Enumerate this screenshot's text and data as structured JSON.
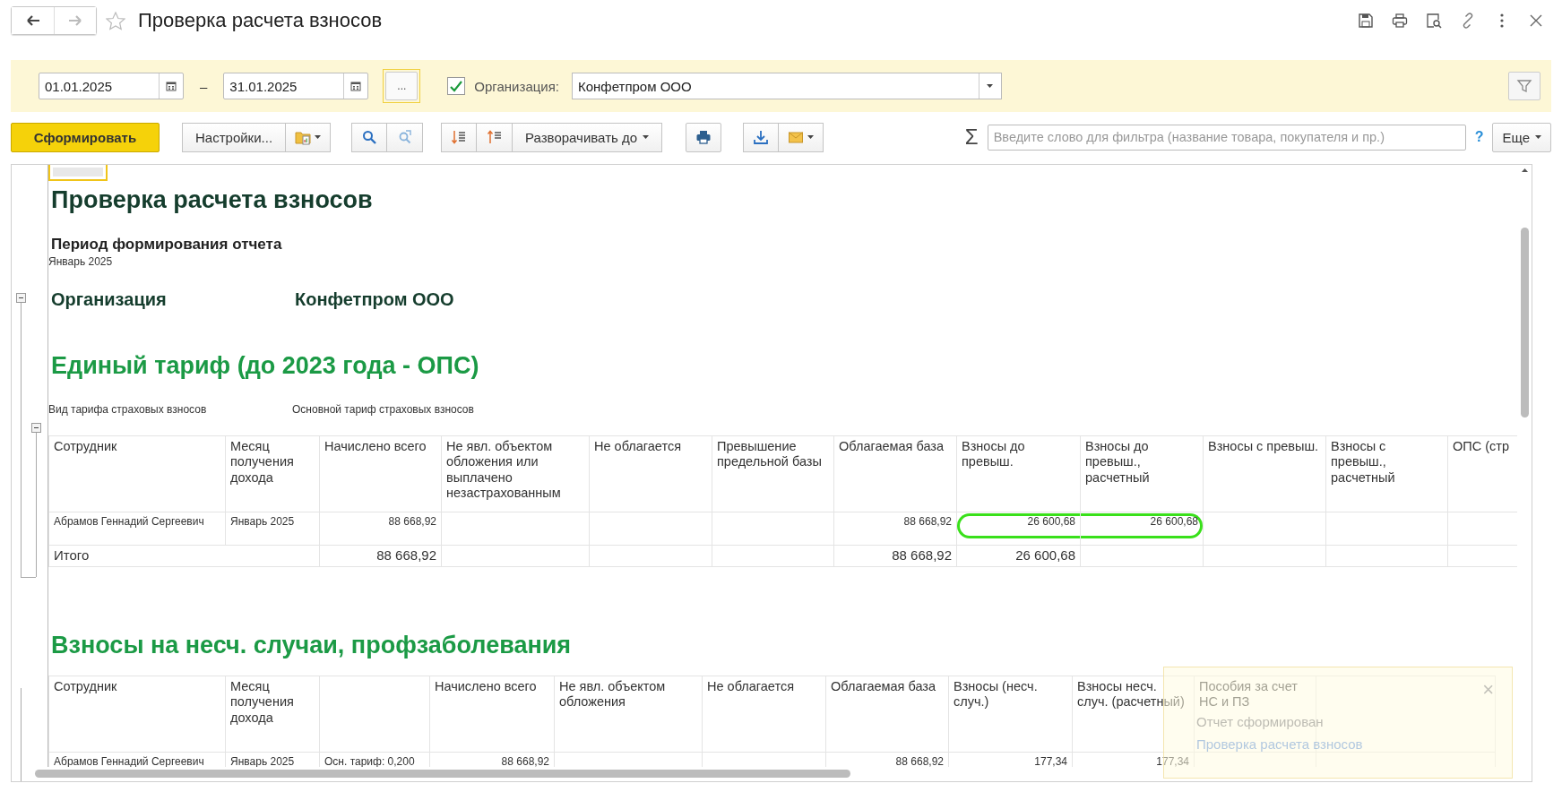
{
  "window": {
    "title": "Проверка расчета взносов"
  },
  "filters": {
    "date_from": "01.01.2025",
    "dash": "–",
    "date_to": "31.01.2025",
    "period_button": "...",
    "organization_checked": true,
    "organization_label": "Организация:",
    "organization": "Конфетпром ООО"
  },
  "toolbar": {
    "generate": "Сформировать",
    "settings": "Настройки...",
    "expand": "Разворачивать до",
    "sum": "Σ",
    "search_placeholder": "Введите слово для фильтра (название товара, покупателя и пр.)",
    "help": "?",
    "more": "Еще"
  },
  "report": {
    "title": "Проверка расчета взносов",
    "period_label": "Период формирования отчета",
    "period": "Январь 2025",
    "org_label": "Организация",
    "org": "Конфетпром ООО",
    "sections": [
      {
        "title": "Единый тариф (до 2023 года - ОПС)",
        "tariff_label": "Вид тарифа страховых взносов",
        "tariff_value": "Основной тариф страховых взносов",
        "table": {
          "columns": [
            "Сотрудник",
            "Месяц получения дохода",
            "Начислено всего",
            "Не явл. объектом обложения или выплачено незастрахованным",
            "Не облагается",
            "Превышение предельной базы",
            "Облагаемая база",
            "Взносы до превыш.",
            "Взносы до превыш., расчетный",
            "Взносы с превыш.",
            "Взносы с превыш., расчетный",
            "ОПС (стр"
          ],
          "rows": [
            {
              "cells": [
                "Абрамов Геннадий Сергеевич",
                "Январь 2025",
                "88 668,92",
                null,
                null,
                null,
                "88 668,92",
                {
                  "text": "26 600,68",
                  "circled": true
                },
                {
                  "text": "26 600,68",
                  "circled": true
                },
                null,
                null,
                null
              ]
            }
          ],
          "total": {
            "label": "Итого",
            "cells": [
              "88 668,92",
              null,
              null,
              null,
              "88 668,92",
              "26 600,68",
              null,
              null,
              null,
              null
            ]
          }
        }
      },
      {
        "title": "Взносы на несч. случаи, профзаболевания",
        "table": {
          "columns": [
            "Сотрудник",
            "Месяц получения дохода",
            null,
            "Начислено всего",
            "Не явл. объектом обложения",
            "Не облагается",
            "Облагаемая база",
            "Взносы (несч. случ.)",
            "Взносы несч. случ. (расчетный)",
            "Пособия за счет НС и ПЗ",
            null
          ],
          "rows": [
            {
              "cells": [
                "Абрамов Геннадий Сергеевич",
                "Январь 2025",
                "Осн. тариф: 0,200",
                "88 668,92",
                null,
                null,
                "88 668,92",
                "177,34",
                "177,34",
                null,
                null
              ]
            }
          ]
        }
      }
    ]
  },
  "notification": {
    "title": "Отчет сформирован",
    "link": "Проверка расчета взносов",
    "close": "×"
  }
}
